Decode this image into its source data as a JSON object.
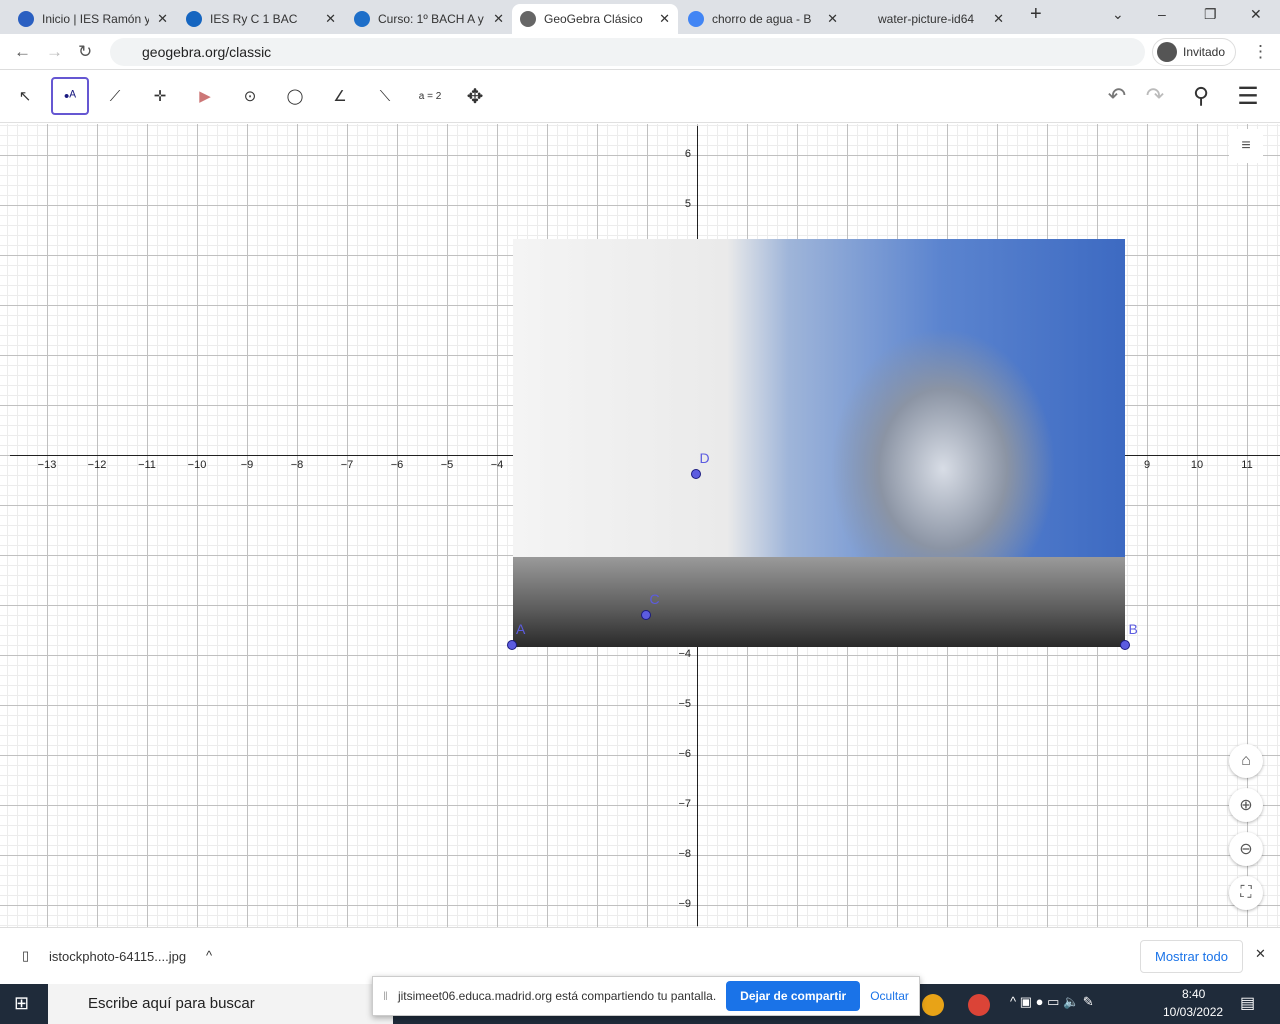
{
  "browser": {
    "tabs": [
      {
        "label": "Inicio | IES Ramón y",
        "color": "#2a5fc1"
      },
      {
        "label": "IES Ry C 1 BAC",
        "color": "#1565c0"
      },
      {
        "label": "Curso: 1º BACH A y",
        "color": "#1e6fc9"
      },
      {
        "label": "GeoGebra Clásico",
        "color": "#666",
        "active": true
      },
      {
        "label": "chorro de agua - B",
        "color": "#4285f4"
      },
      {
        "label": "water-picture-id64",
        "color": "#dee1e6"
      }
    ],
    "url": "geogebra.org/classic",
    "profile": "Invitado"
  },
  "toolbar": {
    "tools": [
      "move",
      "point",
      "line",
      "perpendicular",
      "polygon",
      "circle",
      "circle-3pts",
      "angle",
      "reflect",
      "slider",
      "move-view"
    ],
    "slider_label": "a = 2"
  },
  "graph": {
    "x_ticks": [
      -13,
      -12,
      -11,
      -10,
      -9,
      -8,
      -7,
      -6,
      -5,
      -4,
      9,
      10,
      11
    ],
    "y_ticks": [
      6,
      5,
      -4,
      -5,
      -6,
      -7,
      -8,
      -9
    ],
    "points": [
      {
        "name": "A",
        "x": -3.7,
        "y": -3.8
      },
      {
        "name": "B",
        "x": 8.55,
        "y": -3.8
      },
      {
        "name": "C",
        "x": -1.03,
        "y": -3.2
      },
      {
        "name": "D",
        "x": -0.03,
        "y": -0.37
      }
    ]
  },
  "downloads": {
    "file": "istockphoto-64115....jpg",
    "show_all": "Mostrar todo"
  },
  "share": {
    "message": "jitsimeet06.educa.madrid.org está compartiendo tu pantalla.",
    "stop": "Dejar de compartir",
    "hide": "Ocultar"
  },
  "taskbar": {
    "search": "Escribe aquí para buscar",
    "time": "8:40",
    "date": "10/03/2022"
  }
}
